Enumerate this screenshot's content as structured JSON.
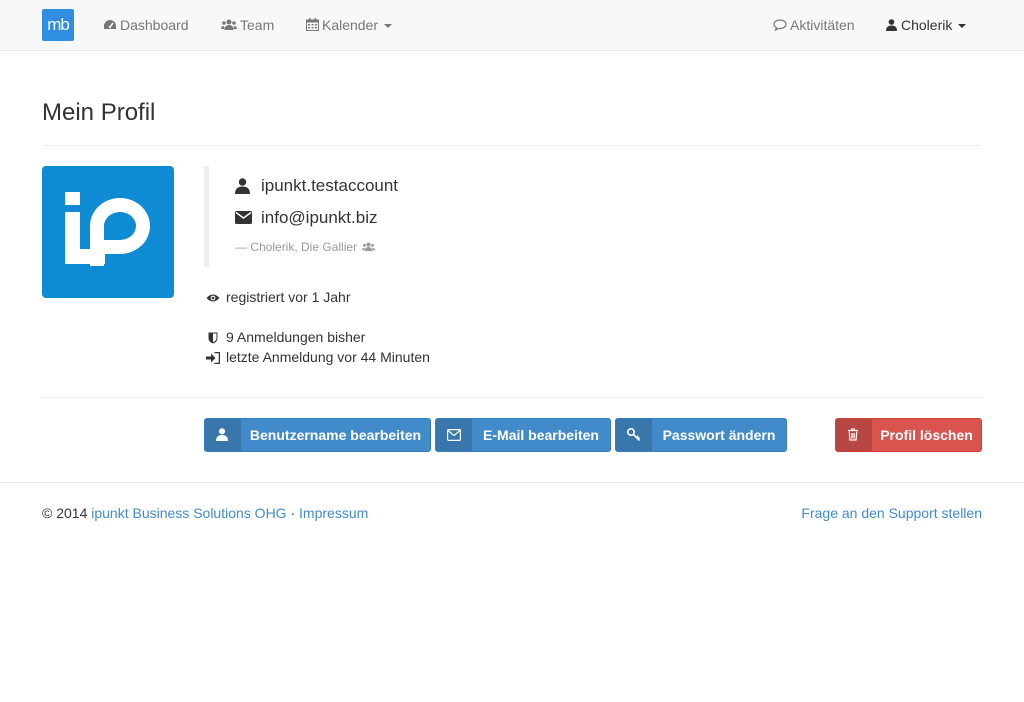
{
  "navbar": {
    "brand_text": "mb",
    "dashboard": "Dashboard",
    "team": "Team",
    "calendar": "Kalender",
    "activities": "Aktivitäten",
    "user": "Cholerik",
    "brand_color": "#2f8ee0"
  },
  "page": {
    "title": "Mein Profil"
  },
  "profile": {
    "avatar_text": "ip",
    "avatar_color": "#0e8bd2",
    "username": "ipunkt.testaccount",
    "email": "info@ipunkt.biz",
    "footer_line": "— Cholerik, Die Gallier",
    "registered": "registriert vor 1 Jahr",
    "logins": "9 Anmeldungen bisher",
    "last_login": "letzte Anmeldung vor 44 Minuten"
  },
  "buttons": {
    "edit_username": "Benutzername bearbeiten",
    "edit_email": "E-Mail bearbeiten",
    "change_password": "Passwort ändern",
    "delete_profile": "Profil löschen",
    "primary_color": "#428bca",
    "danger_color": "#d9534f"
  },
  "footer": {
    "copyright": "© 2014",
    "company": "ipunkt Business Solutions OHG",
    "separator": "·",
    "imprint": "Impressum",
    "support": "Frage an den Support stellen"
  }
}
